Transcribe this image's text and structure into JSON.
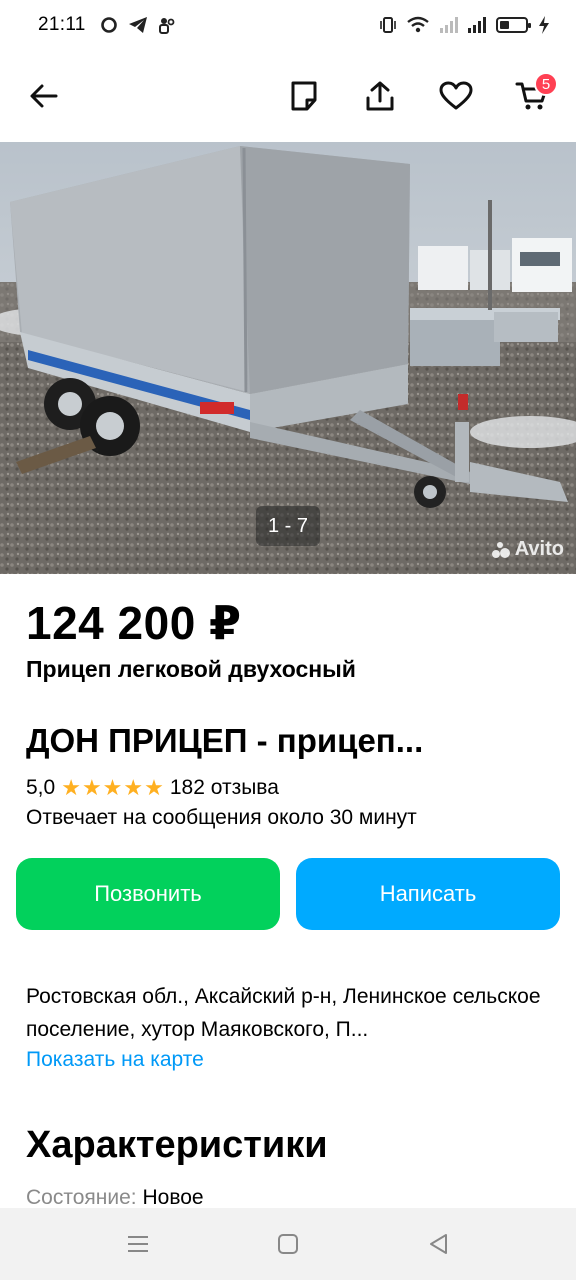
{
  "status_bar": {
    "time": "21:11"
  },
  "toolbar": {
    "cart_count": "5"
  },
  "gallery": {
    "counter": "1 - 7",
    "watermark": "Avito"
  },
  "listing": {
    "price": "124 200 ₽",
    "title": "Прицеп легковой двухосный"
  },
  "seller": {
    "name": "ДОН ПРИЦЕП - прицеп...",
    "rating": "5,0",
    "stars": 5,
    "reviews": "182 отзыва",
    "response_time": "Отвечает на сообщения около 30 минут"
  },
  "actions": {
    "call_label": "Позвонить",
    "write_label": "Написать"
  },
  "location": {
    "address": "Ростовская обл., Аксайский р-н, Ленинское сельское поселение, хутор Маяковского, П...",
    "map_link": "Показать на карте"
  },
  "characteristics": {
    "title": "Характеристики",
    "condition_label": "Состояние:",
    "condition_value": "Новое"
  },
  "colors": {
    "call": "#02d15c",
    "write": "#00aaff",
    "link": "#0099f7",
    "badge": "#ff4053",
    "star": "#ffb021"
  }
}
